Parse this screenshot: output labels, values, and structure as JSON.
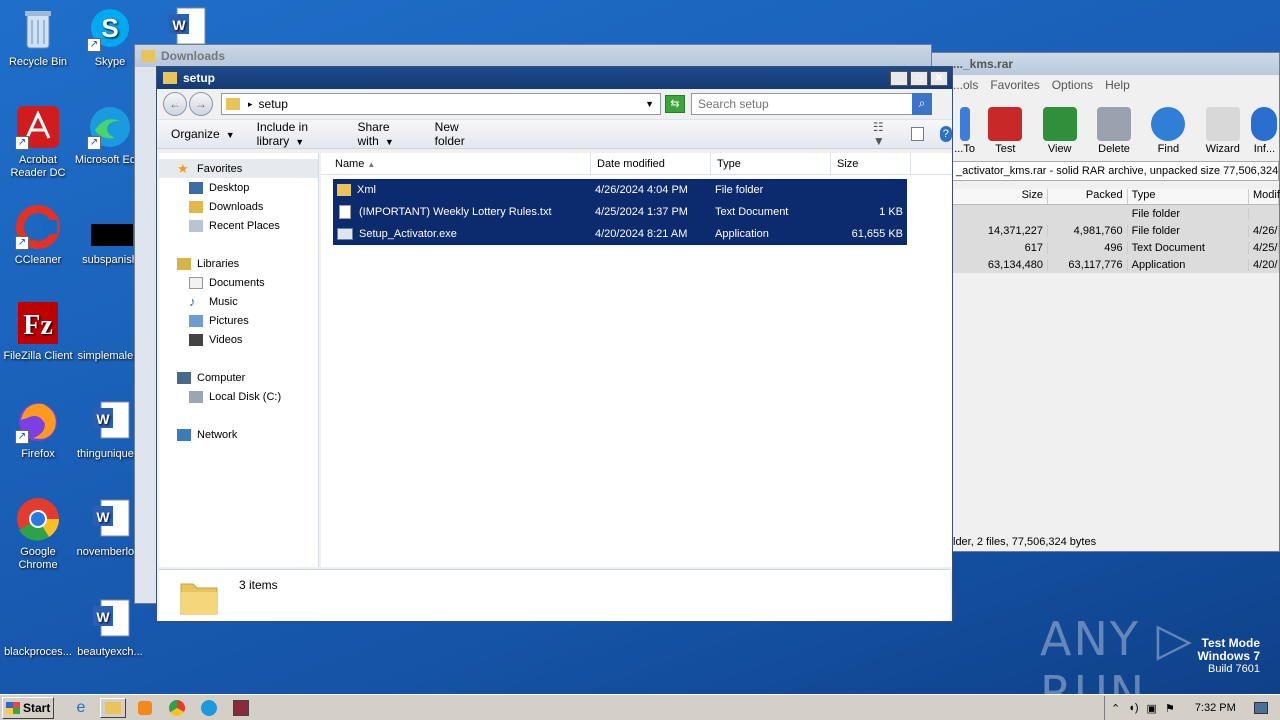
{
  "desktop": {
    "icons": [
      {
        "label": "Recycle Bin"
      },
      {
        "label": "Skype"
      },
      {
        "label": "Acrobat Reader DC"
      },
      {
        "label": "Microsoft Ed..."
      },
      {
        "label": "CCleaner"
      },
      {
        "label": "subspanish"
      },
      {
        "label": "FileZilla Client"
      },
      {
        "label": "simplemale..."
      },
      {
        "label": "Firefox"
      },
      {
        "label": "thingunique..."
      },
      {
        "label": "Google Chrome"
      },
      {
        "label": "novemberlo..."
      },
      {
        "label": "blackproces..."
      },
      {
        "label": "beautyexch..."
      }
    ],
    "watermark": {
      "line1": "Test Mode",
      "line2": "Windows 7",
      "line3": "Build 7601"
    },
    "brand": "ANY ▷ RUN"
  },
  "downloads_window": {
    "title": "Downloads"
  },
  "winrar": {
    "title": "..._kms.rar",
    "menu": [
      "...ols",
      "Favorites",
      "Options",
      "Help"
    ],
    "tools": [
      "...To",
      "Test",
      "View",
      "Delete",
      "Find",
      "Wizard",
      "Inf..."
    ],
    "path": "_activator_kms.rar - solid RAR archive, unpacked size 77,506,324 by",
    "columns": [
      "Size",
      "Packed",
      "Type",
      "Modif"
    ],
    "rows": [
      {
        "size": "",
        "packed": "",
        "type": "File folder",
        "mod": ""
      },
      {
        "size": "14,371,227",
        "packed": "4,981,760",
        "type": "File folder",
        "mod": "4/26/"
      },
      {
        "size": "617",
        "packed": "496",
        "type": "Text Document",
        "mod": "4/25/"
      },
      {
        "size": "63,134,480",
        "packed": "63,117,776",
        "type": "Application",
        "mod": "4/20/"
      }
    ],
    "status": "lder, 2 files, 77,506,324 bytes"
  },
  "setup_window": {
    "title": "setup",
    "address": "setup",
    "search_placeholder": "Search setup",
    "commands": {
      "organize": "Organize",
      "include": "Include in library",
      "share": "Share with",
      "newfolder": "New folder"
    },
    "nav": {
      "favorites": "Favorites",
      "desktop": "Desktop",
      "downloads": "Downloads",
      "recent": "Recent Places",
      "libraries": "Libraries",
      "documents": "Documents",
      "music": "Music",
      "pictures": "Pictures",
      "videos": "Videos",
      "computer": "Computer",
      "localdisk": "Local Disk (C:)",
      "network": "Network"
    },
    "columns": {
      "name": "Name",
      "date": "Date modified",
      "type": "Type",
      "size": "Size"
    },
    "files": [
      {
        "name": "Xml",
        "date": "4/26/2024 4:04 PM",
        "type": "File folder",
        "size": ""
      },
      {
        "name": "(IMPORTANT) Weekly Lottery Rules.txt",
        "date": "4/25/2024 1:37 PM",
        "type": "Text Document",
        "size": "1 KB"
      },
      {
        "name": "Setup_Activator.exe",
        "date": "4/20/2024 8:21 AM",
        "type": "Application",
        "size": "61,655 KB"
      }
    ],
    "item_count": "3 items"
  },
  "taskbar": {
    "start": "Start",
    "time": "7:32 PM"
  }
}
